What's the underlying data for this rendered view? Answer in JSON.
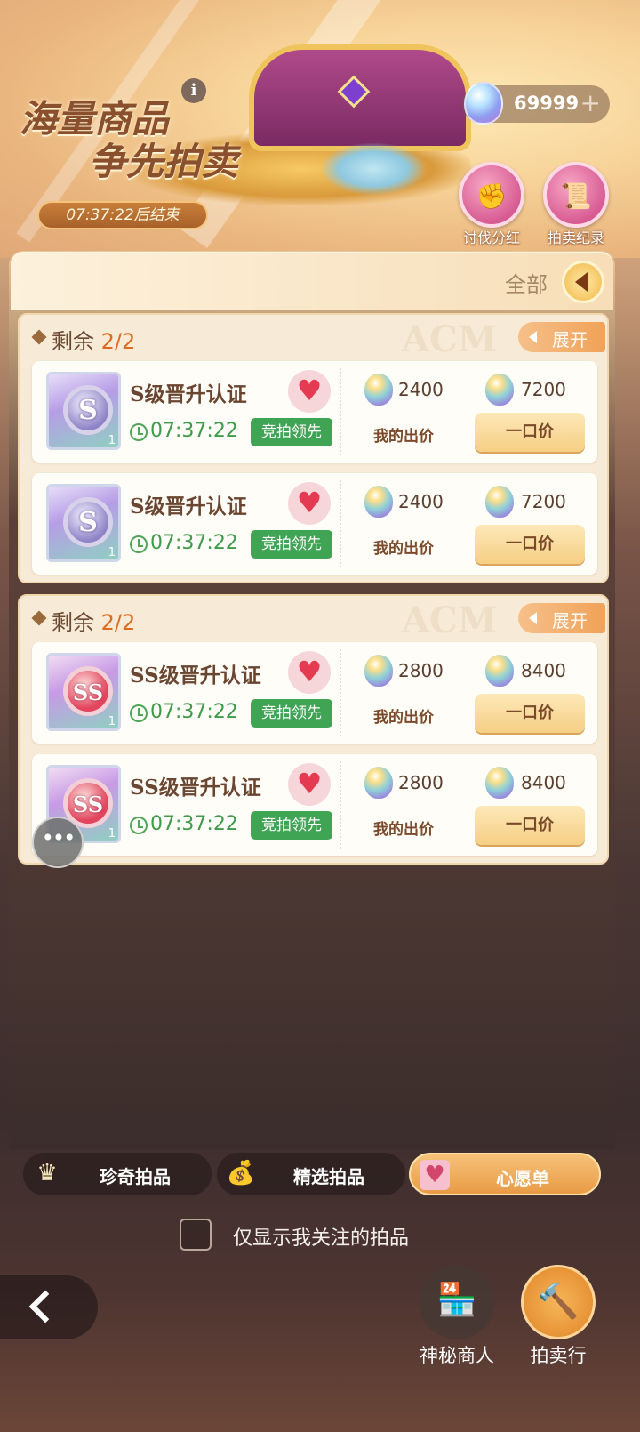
{
  "banner": {
    "title_line1": "海量商品",
    "title_line2": "争先拍卖",
    "info_icon": "i",
    "countdown": "07:37:22后结束"
  },
  "currency": {
    "amount": "69999",
    "plus": "+"
  },
  "top_buttons": [
    {
      "label": "讨伐分红",
      "icon": "fist-icon",
      "glyph": "✊"
    },
    {
      "label": "拍卖纪录",
      "icon": "scroll-icon",
      "glyph": "📜"
    }
  ],
  "filter": {
    "label": "全部"
  },
  "groups": [
    {
      "remaining_label": "剩余",
      "remaining_count": "2/2",
      "expand_label": "展开",
      "items": [
        {
          "name": "S级晋升认证",
          "badge": "S",
          "qty": "1",
          "time": "07:37:22",
          "status": "竞拍领先",
          "bid_price": "2400",
          "buyout_price": "7200",
          "my_bid_label": "我的出价",
          "buyout_label": "一口价"
        },
        {
          "name": "S级晋升认证",
          "badge": "S",
          "qty": "1",
          "time": "07:37:22",
          "status": "竞拍领先",
          "bid_price": "2400",
          "buyout_price": "7200",
          "my_bid_label": "我的出价",
          "buyout_label": "一口价"
        }
      ]
    },
    {
      "remaining_label": "剩余",
      "remaining_count": "2/2",
      "expand_label": "展开",
      "items": [
        {
          "name": "SS级晋升认证",
          "badge": "SS",
          "qty": "1",
          "time": "07:37:22",
          "status": "竞拍领先",
          "bid_price": "2800",
          "buyout_price": "8400",
          "my_bid_label": "我的出价",
          "buyout_label": "一口价"
        },
        {
          "name": "SS级晋升认证",
          "badge": "SS",
          "qty": "1",
          "time": "07:37:22",
          "status": "竞拍领先",
          "bid_price": "2800",
          "buyout_price": "8400",
          "my_bid_label": "我的出价",
          "buyout_label": "一口价"
        }
      ]
    }
  ],
  "tabs": [
    {
      "label": "珍奇拍品",
      "icon": "crown-icon",
      "glyph": "♛",
      "active": false
    },
    {
      "label": "精选拍品",
      "icon": "money-bag-icon",
      "glyph": "💰",
      "active": false
    },
    {
      "label": "心愿单",
      "icon": "wishlist-icon",
      "glyph": "♥",
      "active": true
    }
  ],
  "only_followed": {
    "label": "仅显示我关注的拍品",
    "checked": false
  },
  "footer": {
    "shop_label": "神秘商人",
    "auction_label": "拍卖行"
  },
  "colors": {
    "lead_green": "#3fa454",
    "accent_orange": "#e06b1f",
    "heart_red": "#e43a52"
  }
}
